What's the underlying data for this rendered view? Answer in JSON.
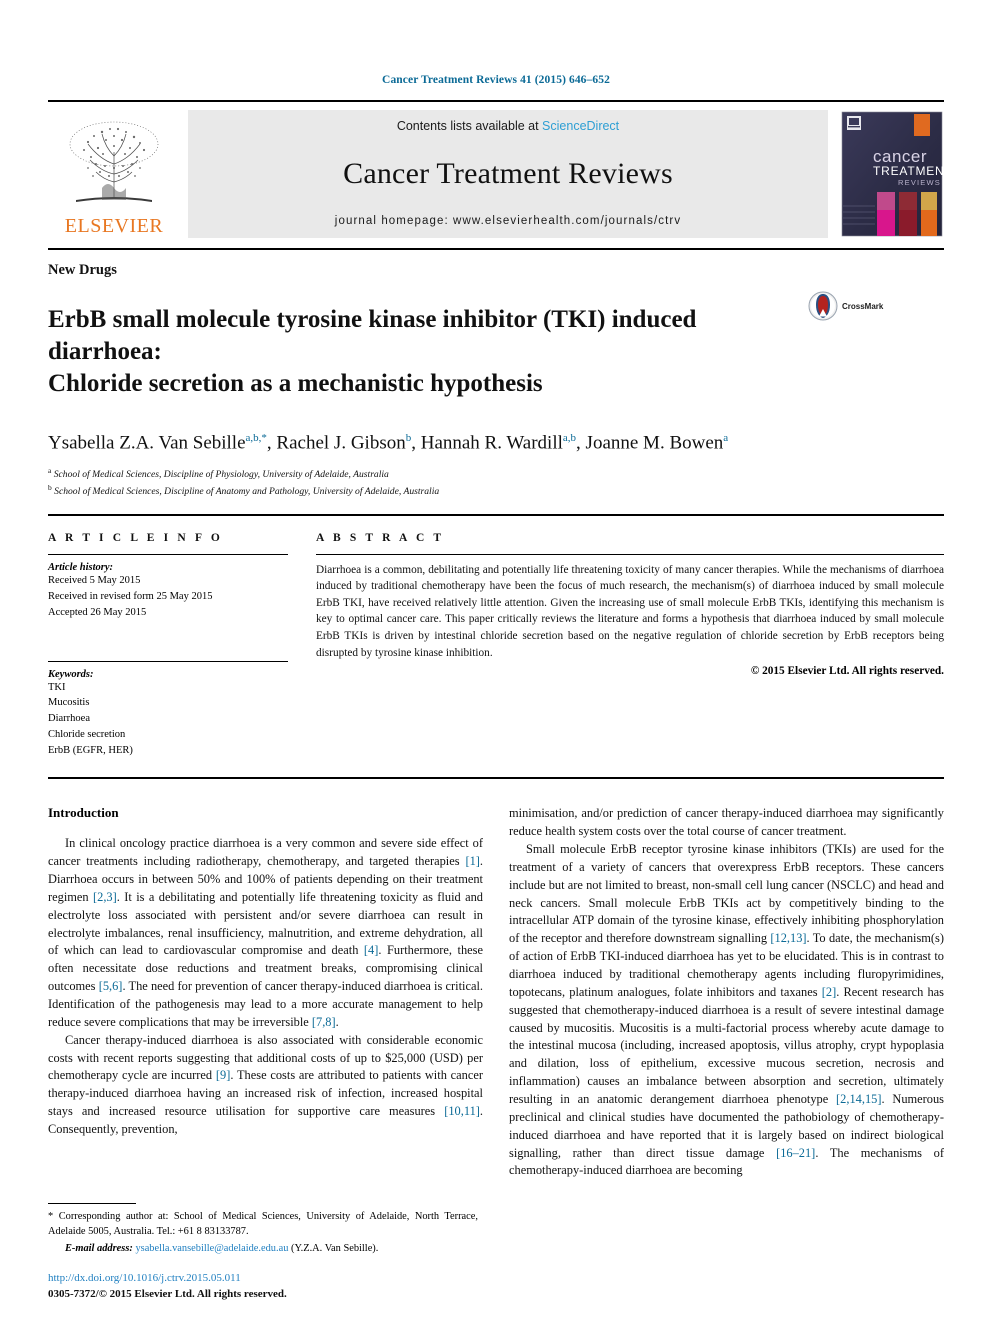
{
  "running_head": "Cancer Treatment Reviews 41 (2015) 646–652",
  "masthead": {
    "publisher_name": "ELSEVIER",
    "contents_prefix": "Contents lists available at ",
    "sciencedirect": "ScienceDirect",
    "journal_name": "Cancer Treatment Reviews",
    "homepage": "journal homepage: www.elsevierhealth.com/journals/ctrv",
    "cover_title_line1": "cancer",
    "cover_title_line2": "TREATMENT",
    "cover_title_line3": "REVIEWS"
  },
  "article": {
    "kicker": "New Drugs",
    "title_line1": "ErbB small molecule tyrosine kinase inhibitor (TKI) induced diarrhoea:",
    "title_line2": "Chloride secretion as a mechanistic hypothesis",
    "crossmark_label": "CrossMark",
    "authors": [
      {
        "name": "Ysabella Z.A. Van Sebille",
        "marks": "a,b,*"
      },
      {
        "name": "Rachel J. Gibson",
        "marks": "b"
      },
      {
        "name": "Hannah R. Wardill",
        "marks": "a,b"
      },
      {
        "name": "Joanne M. Bowen",
        "marks": "a"
      }
    ],
    "affiliations": [
      {
        "mark": "a",
        "text": "School of Medical Sciences, Discipline of Physiology, University of Adelaide, Australia"
      },
      {
        "mark": "b",
        "text": "School of Medical Sciences, Discipline of Anatomy and Pathology, University of Adelaide, Australia"
      }
    ]
  },
  "info": {
    "heading": "A R T I C L E   I N F O",
    "history_label": "Article history:",
    "history": [
      "Received 5 May 2015",
      "Received in revised form 25 May 2015",
      "Accepted 26 May 2015"
    ],
    "keywords_label": "Keywords:",
    "keywords": [
      "TKI",
      "Mucositis",
      "Diarrhoea",
      "Chloride secretion",
      "ErbB (EGFR, HER)"
    ]
  },
  "abstract": {
    "heading": "A B S T R A C T",
    "text": "Diarrhoea is a common, debilitating and potentially life threatening toxicity of many cancer therapies. While the mechanisms of diarrhoea induced by traditional chemotherapy have been the focus of much research, the mechanism(s) of diarrhoea induced by small molecule ErbB TKI, have received relatively little attention. Given the increasing use of small molecule ErbB TKIs, identifying this mechanism is key to optimal cancer care. This paper critically reviews the literature and forms a hypothesis that diarrhoea induced by small molecule ErbB TKIs is driven by intestinal chloride secretion based on the negative regulation of chloride secretion by ErbB receptors being disrupted by tyrosine kinase inhibition.",
    "copyright": "© 2015 Elsevier Ltd. All rights reserved."
  },
  "body": {
    "intro_heading": "Introduction",
    "left_paragraphs": [
      {
        "segments": [
          {
            "t": "In clinical oncology practice diarrhoea is a very common and severe side effect of cancer treatments including radiotherapy, chemotherapy, and targeted therapies "
          },
          {
            "t": "[1]",
            "ref": true
          },
          {
            "t": ". Diarrhoea occurs in between 50% and 100% of patients depending on their treatment regimen "
          },
          {
            "t": "[2,3]",
            "ref": true
          },
          {
            "t": ". It is a debilitating and potentially life threatening toxicity as fluid and electrolyte loss associated with persistent and/or severe diarrhoea can result in electrolyte imbalances, renal insufficiency, malnutrition, and extreme dehydration, all of which can lead to cardiovascular compromise and death "
          },
          {
            "t": "[4]",
            "ref": true
          },
          {
            "t": ". Furthermore, these often necessitate dose reductions and treatment breaks, compromising clinical outcomes "
          },
          {
            "t": "[5,6]",
            "ref": true
          },
          {
            "t": ". The need for prevention of cancer therapy-induced diarrhoea is critical. Identification of the pathogenesis may lead to a more accurate management to help reduce severe complications that may be irreversible "
          },
          {
            "t": "[7,8]",
            "ref": true
          },
          {
            "t": "."
          }
        ]
      },
      {
        "segments": [
          {
            "t": "Cancer therapy-induced diarrhoea is also associated with considerable economic costs with recent reports suggesting that additional costs of up to $25,000 (USD) per chemotherapy cycle are incurred "
          },
          {
            "t": "[9]",
            "ref": true
          },
          {
            "t": ". These costs are attributed to patients with cancer therapy-induced diarrhoea having an increased risk of infection, increased hospital stays and increased resource utilisation for supportive care measures "
          },
          {
            "t": "[10,11]",
            "ref": true
          },
          {
            "t": ". Consequently, prevention,"
          }
        ]
      }
    ],
    "right_paragraphs": [
      {
        "segments": [
          {
            "t": "minimisation, and/or prediction of cancer therapy-induced diarrhoea may significantly reduce health system costs over the total course of cancer treatment.",
            "noindent": true
          }
        ]
      },
      {
        "segments": [
          {
            "t": "Small molecule ErbB receptor tyrosine kinase inhibitors (TKIs) are used for the treatment of a variety of cancers that overexpress ErbB receptors. These cancers include but are not limited to breast, non-small cell lung cancer (NSCLC) and head and neck cancers. Small molecule ErbB TKIs act by competitively binding to the intracellular ATP domain of the tyrosine kinase, effectively inhibiting phosphorylation of the receptor and therefore downstream signalling "
          },
          {
            "t": "[12,13]",
            "ref": true
          },
          {
            "t": ". To date, the mechanism(s) of action of ErbB TKI-induced diarrhoea has yet to be elucidated. This is in contrast to diarrhoea induced by traditional chemotherapy agents including fluropyrimidines, topotecans, platinum analogues, folate inhibitors and taxanes "
          },
          {
            "t": "[2]",
            "ref": true
          },
          {
            "t": ". Recent research has suggested that chemotherapy-induced diarrhoea is a result of severe intestinal damage caused by mucositis. Mucositis is a multi-factorial process whereby acute damage to the intestinal mucosa (including, increased apoptosis, villus atrophy, crypt hypoplasia and dilation, loss of epithelium, excessive mucous secretion, necrosis and inflammation) causes an imbalance between absorption and secretion, ultimately resulting in an anatomic derangement diarrhoea phenotype "
          },
          {
            "t": "[2,14,15]",
            "ref": true
          },
          {
            "t": ". Numerous preclinical and clinical studies have documented the pathobiology of chemotherapy-induced diarrhoea and have reported that it is largely based on indirect biological signalling, rather than direct tissue damage "
          },
          {
            "t": "[16–21]",
            "ref": true
          },
          {
            "t": ". The mechanisms of chemotherapy-induced diarrhoea are becoming"
          }
        ]
      }
    ]
  },
  "footnote": {
    "corresponding": "* Corresponding author at: School of Medical Sciences, University of Adelaide, North Terrace, Adelaide 5005, Australia. Tel.: +61 8 83133787.",
    "email_label": "E-mail address:",
    "email": "ysabella.vansebille@adelaide.edu.au",
    "email_owner": "(Y.Z.A. Van Sebille)."
  },
  "footer": {
    "doi": "http://dx.doi.org/10.1016/j.ctrv.2015.05.011",
    "issn": "0305-7372/© 2015 Elsevier Ltd. All rights reserved."
  },
  "colors": {
    "link": "#1f7fc0",
    "running_head": "#0b6a96",
    "elsevier_orange": "#E87722",
    "sciencedirect": "#2e9fd4"
  }
}
